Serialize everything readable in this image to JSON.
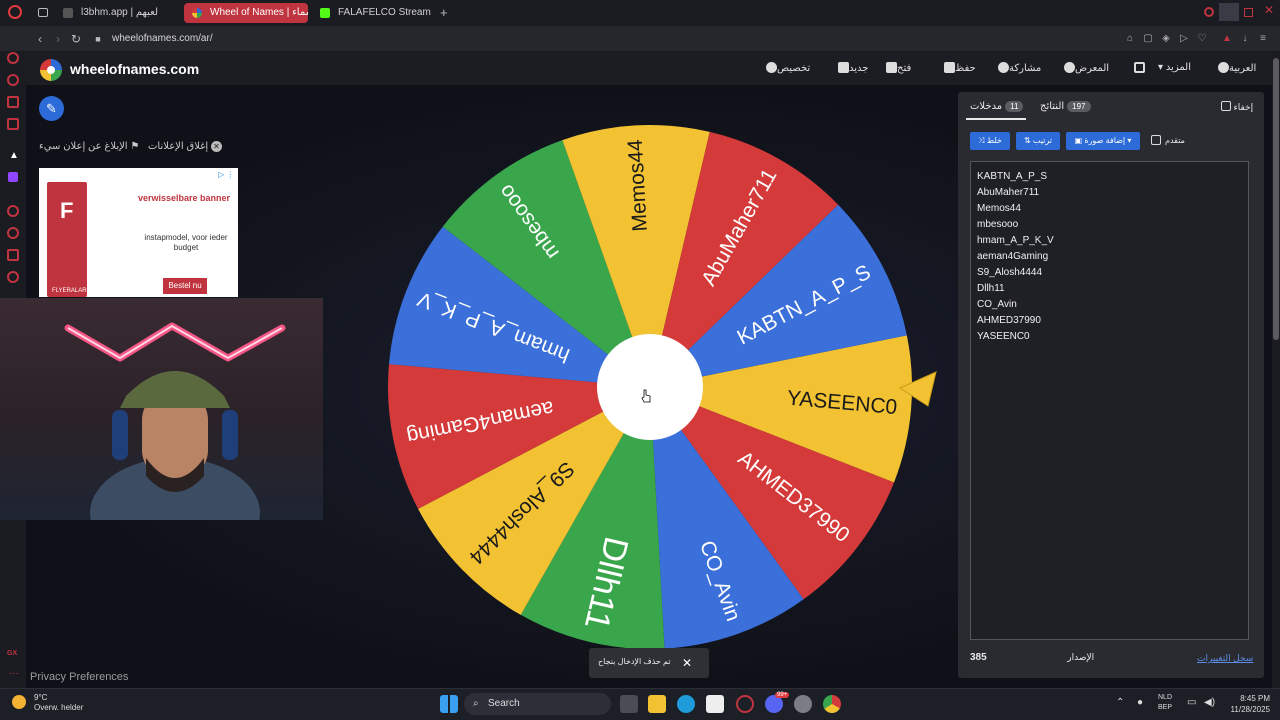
{
  "browser": {
    "tabs": [
      {
        "label": "l3bhm.app | لعبهم",
        "active": false
      },
      {
        "label": "Wheel of Names | عجلة الأسماء",
        "active": true
      },
      {
        "label": "FALAFELCO Stream - Watch",
        "active": false
      }
    ],
    "new_tab_symbol": "+",
    "url": "wheelofnames.com/ar/"
  },
  "site": {
    "name": "wheelofnames.com",
    "menu": {
      "customize": "تخصيص",
      "new": "جديد",
      "open": "فتح",
      "save": "حفظ",
      "share": "مشاركة",
      "gallery": "المعرض",
      "more": "المزيد",
      "language": "العربية"
    }
  },
  "left": {
    "report_ad": "الإبلاغ عن إعلان سيء",
    "close_ads": "إغلاق الإعلانات",
    "ad": {
      "title": "verwisselbare banner",
      "subtitle": "instapmodel, voor ieder budget",
      "button": "Bestel nu",
      "brand": "FLYERALARM"
    },
    "privacy": "Privacy Preferences"
  },
  "wheel": {
    "segments": [
      {
        "name": "YASEENC0",
        "color": "#f2c232"
      },
      {
        "name": "AHMED37990",
        "color": "#d53a3a"
      },
      {
        "name": "CO_Avin",
        "color": "#3b6fd9"
      },
      {
        "name": "Dllh11",
        "color": "#3aa64c"
      },
      {
        "name": "S9_Alosh4444",
        "color": "#f2c232"
      },
      {
        "name": "aeman4Gaming",
        "color": "#d53a3a"
      },
      {
        "name": "hmam_A_P_K_V",
        "color": "#3b6fd9"
      },
      {
        "name": "mbesooo",
        "color": "#3aa64c"
      },
      {
        "name": "Memos44",
        "color": "#f2c232"
      },
      {
        "name": "AbuMaher711",
        "color": "#d53a3a"
      },
      {
        "name": "KABTN_A_P_S",
        "color": "#3b6fd9"
      }
    ]
  },
  "panel": {
    "hide_label": "إخفاء",
    "entries_tab": "مدخلات",
    "entries_count": "11",
    "results_tab": "النتائج",
    "results_count": "197",
    "shuffle": "خلط",
    "sort": "ترتيب",
    "add_image": "إضافة صورة",
    "advanced": "متقدم",
    "entries": [
      "KABTN_A_P_S",
      "AbuMaher711",
      "Memos44",
      "mbesooo",
      "hmam_A_P_K_V",
      "aeman4Gaming",
      "S9_Alosh4444",
      "Dllh11",
      "CO_Avin",
      "AHMED37990",
      "YASEENC0"
    ],
    "version_label": "الإصدار",
    "version_number": "385",
    "changelog": "سجل التغييرات"
  },
  "toast": {
    "text": "تم حذف الإدخال بنجاح",
    "close": "✕"
  },
  "taskbar": {
    "temp": "9°C",
    "weather": "Overw. helder",
    "search": "Search",
    "lang_top": "NLD",
    "lang_bottom": "BEP",
    "time": "8:45 PM",
    "date": "11/28/2025",
    "notif_badge": "99+"
  }
}
